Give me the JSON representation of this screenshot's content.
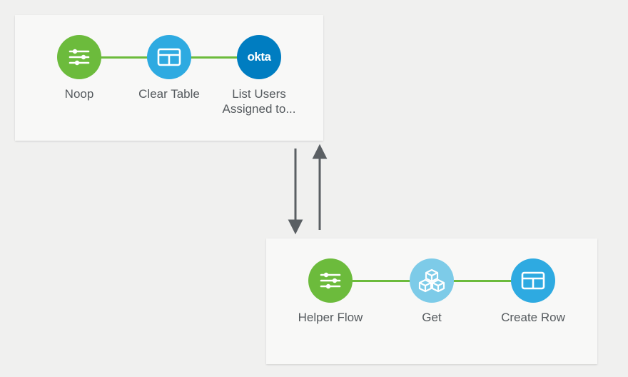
{
  "flows": {
    "top": {
      "nodes": [
        {
          "id": "noop",
          "label": "Noop",
          "icon": "sliders",
          "color": "green"
        },
        {
          "id": "clear-table",
          "label": "Clear Table",
          "icon": "table",
          "color": "blue"
        },
        {
          "id": "list-users",
          "label": "List Users\nAssigned to...",
          "icon": "okta",
          "color": "navy"
        }
      ]
    },
    "bottom": {
      "nodes": [
        {
          "id": "helper-flow",
          "label": "Helper Flow",
          "icon": "sliders",
          "color": "green"
        },
        {
          "id": "get",
          "label": "Get",
          "icon": "cubes",
          "color": "light"
        },
        {
          "id": "create-row",
          "label": "Create Row",
          "icon": "table",
          "color": "blue"
        }
      ]
    }
  },
  "brand": {
    "okta_wordmark": "okta"
  },
  "colors": {
    "green": "#6cbb3c",
    "blue": "#2eaae1",
    "navy": "#007dc1",
    "light": "#7dcbe8",
    "connector": "#6cbb3c",
    "arrow": "#5a5f63",
    "label": "#555a5e"
  }
}
